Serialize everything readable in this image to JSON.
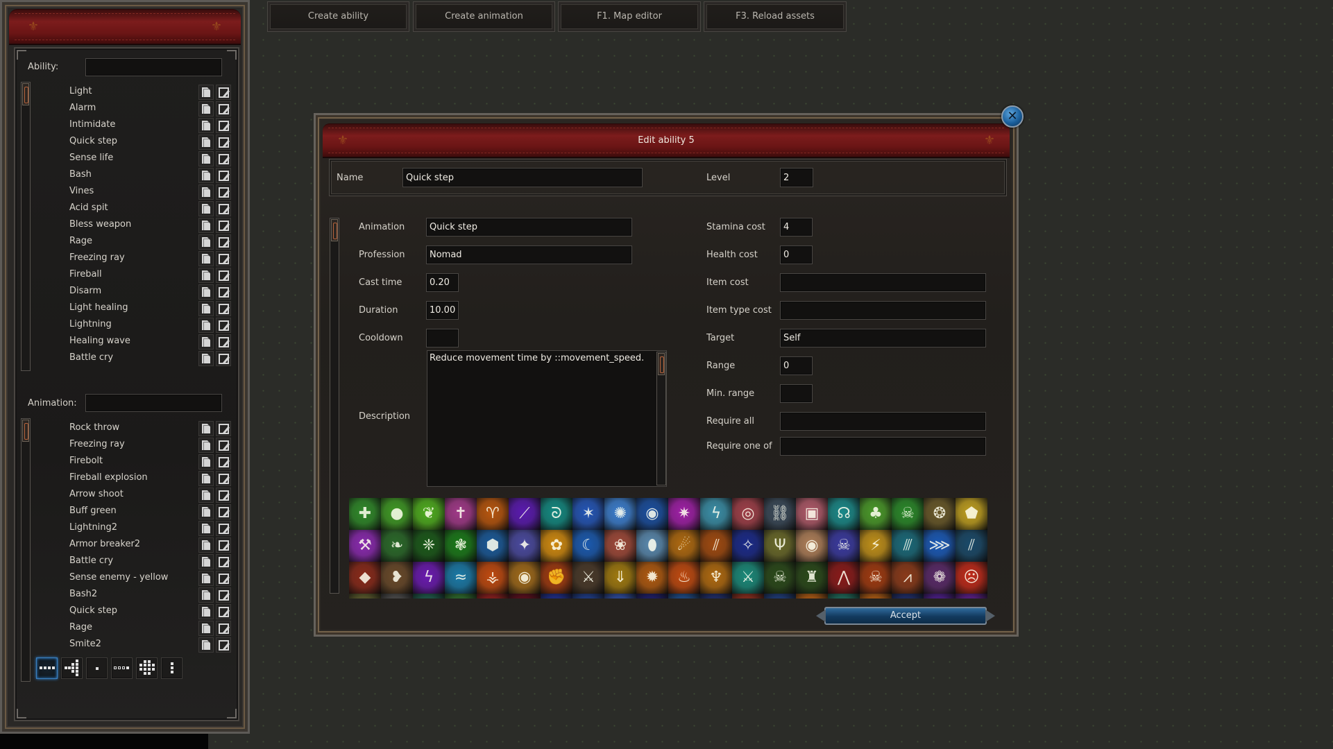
{
  "top_buttons": [
    {
      "label": "Create ability"
    },
    {
      "label": "Create animation"
    },
    {
      "label": "F1. Map editor"
    },
    {
      "label": "F3. Reload assets"
    }
  ],
  "left_panel": {
    "ability_label": "Ability:",
    "ability_filter": "",
    "abilities": [
      "Light",
      "Alarm",
      "Intimidate",
      "Quick step",
      "Sense life",
      "Bash",
      "Vines",
      "Acid spit",
      "Bless weapon",
      "Rage",
      "Freezing ray",
      "Fireball",
      "Disarm",
      "Light healing",
      "Lightning",
      "Healing wave",
      "Battle cry"
    ],
    "animation_label": "Animation:",
    "animation_filter": "",
    "animations": [
      "Rock throw",
      "Freezing ray",
      "Firebolt",
      "Fireball explosion",
      "Arrow shoot",
      "Buff green",
      "Lightning2",
      "Armor breaker2",
      "Battle cry",
      "Sense enemy - yellow",
      "Bash2",
      "Quick step",
      "Rage",
      "Smite2"
    ],
    "row_actions": {
      "copy": "copy-icon",
      "edit": "edit-icon"
    },
    "layout_buttons": [
      {
        "name": "line-4-layout",
        "selected": true
      },
      {
        "name": "arrow-layout",
        "selected": false
      },
      {
        "name": "single-layout",
        "selected": false
      },
      {
        "name": "line-3-plus-1-layout",
        "selected": false
      },
      {
        "name": "circle-layout",
        "selected": false
      },
      {
        "name": "column-3-layout",
        "selected": false
      }
    ]
  },
  "dialog": {
    "title": "Edit ability 5",
    "close_icon": "close-icon",
    "name": {
      "label": "Name",
      "value": "Quick step"
    },
    "level": {
      "label": "Level",
      "value": "2"
    },
    "left_fields": [
      {
        "key": "animation",
        "label": "Animation",
        "value": "Quick step",
        "wide": true
      },
      {
        "key": "profession",
        "label": "Profession",
        "value": "Nomad",
        "wide": true
      },
      {
        "key": "cast_time",
        "label": "Cast time",
        "value": "0.20",
        "wide": false
      },
      {
        "key": "duration",
        "label": "Duration",
        "value": "10.00",
        "wide": false
      },
      {
        "key": "cooldown",
        "label": "Cooldown",
        "value": "",
        "wide": false
      }
    ],
    "description": {
      "label": "Description",
      "value": "Reduce movement time by ::movement_speed."
    },
    "right_fields": [
      {
        "key": "stamina_cost",
        "label": "Stamina cost",
        "value": "4",
        "wide": false
      },
      {
        "key": "health_cost",
        "label": "Health cost",
        "value": "0",
        "wide": false
      },
      {
        "key": "item_cost",
        "label": "Item cost",
        "value": "",
        "wide": true
      },
      {
        "key": "item_type_cost",
        "label": "Item type cost",
        "value": "",
        "wide": true
      },
      {
        "key": "target",
        "label": "Target",
        "value": "Self",
        "wide": true
      },
      {
        "key": "range",
        "label": "Range",
        "value": "0",
        "wide": false
      },
      {
        "key": "min_range",
        "label": "Min. range",
        "value": "",
        "wide": false
      },
      {
        "key": "require_all",
        "label": "Require all",
        "value": "",
        "wide": true
      },
      {
        "key": "require_one_of",
        "label": "Require one of",
        "value": "",
        "wide": true
      }
    ],
    "icons": [
      {
        "name": "holy-cross-icon",
        "glyph": "✚",
        "bg": "#2f8a2a"
      },
      {
        "name": "acid-orb-icon",
        "glyph": "●",
        "bg": "#3f9a25"
      },
      {
        "name": "leaf-icon",
        "glyph": "❦",
        "bg": "#4fae1f"
      },
      {
        "name": "holy-sword-icon",
        "glyph": "✝",
        "bg": "#a23a8a"
      },
      {
        "name": "ram-head-icon",
        "glyph": "♈",
        "bg": "#b8560e"
      },
      {
        "name": "purple-beam-icon",
        "glyph": "⟋",
        "bg": "#5a1ab0"
      },
      {
        "name": "teal-swirl-icon",
        "glyph": "ᘐ",
        "bg": "#138a82"
      },
      {
        "name": "ice-shards-icon",
        "glyph": "✶",
        "bg": "#2456b8"
      },
      {
        "name": "frost-burst-icon",
        "glyph": "✺",
        "bg": "#3c7fd0"
      },
      {
        "name": "water-orb-icon",
        "glyph": "◉",
        "bg": "#1a4fa0"
      },
      {
        "name": "radiant-figure-icon",
        "glyph": "✷",
        "bg": "#a020a8"
      },
      {
        "name": "lightning-cage-icon",
        "glyph": "ϟ",
        "bg": "#3a8fa8"
      },
      {
        "name": "dragon-eye-icon",
        "glyph": "◎",
        "bg": "#a0404a"
      },
      {
        "name": "chain-icon",
        "glyph": "⛓",
        "bg": "#3a4a5a"
      },
      {
        "name": "spellbook-icon",
        "glyph": "▣",
        "bg": "#b05a6a"
      },
      {
        "name": "kraken-icon",
        "glyph": "☊",
        "bg": "#1a8a8a"
      },
      {
        "name": "vine-icon",
        "glyph": "♣",
        "bg": "#4a9a2a"
      },
      {
        "name": "poison-skull-icon",
        "glyph": "☠",
        "bg": "#2a8a2a"
      },
      {
        "name": "treant-icon",
        "glyph": "❂",
        "bg": "#6a5a2a"
      },
      {
        "name": "gold-armor-icon",
        "glyph": "⬟",
        "bg": "#c0a020"
      },
      {
        "name": "purple-axe-icon",
        "glyph": "⚒",
        "bg": "#8a2ab0"
      },
      {
        "name": "olive-branch-icon",
        "glyph": "❧",
        "bg": "#2a6a2a"
      },
      {
        "name": "green-wisp-icon",
        "glyph": "❈",
        "bg": "#1a5a1a"
      },
      {
        "name": "green-tentacles-icon",
        "glyph": "❃",
        "bg": "#1a7a1a"
      },
      {
        "name": "crystal-shield-icon",
        "glyph": "⬢",
        "bg": "#1a5a9a"
      },
      {
        "name": "star-burst-icon",
        "glyph": "✦",
        "bg": "#4a4aa0"
      },
      {
        "name": "golden-brain-icon",
        "glyph": "✿",
        "bg": "#d08a10"
      },
      {
        "name": "ice-wave-icon",
        "glyph": "☾",
        "bg": "#1a5ab0"
      },
      {
        "name": "paw-print-icon",
        "glyph": "❀",
        "bg": "#a04a3a"
      },
      {
        "name": "frost-egg-icon",
        "glyph": "⬮",
        "bg": "#5a8ab0"
      },
      {
        "name": "fire-comet-icon",
        "glyph": "☄",
        "bg": "#b06a10"
      },
      {
        "name": "flame-slash-icon",
        "glyph": "⫽",
        "bg": "#a04a10"
      },
      {
        "name": "blue-stars-icon",
        "glyph": "✧",
        "bg": "#1a2a8a"
      },
      {
        "name": "golden-antler-icon",
        "glyph": "Ψ",
        "bg": "#6a6a2a"
      },
      {
        "name": "eye-icon",
        "glyph": "◉",
        "bg": "#b0805a"
      },
      {
        "name": "spectral-skull-icon",
        "glyph": "☠",
        "bg": "#3a3aa0"
      },
      {
        "name": "golden-slash-icon",
        "glyph": "⚡",
        "bg": "#c0901a"
      },
      {
        "name": "teal-blades-icon",
        "glyph": "⫻",
        "bg": "#1a6a7a"
      },
      {
        "name": "blue-rays-icon",
        "glyph": "⋙",
        "bg": "#1a5ab8"
      },
      {
        "name": "ice-claws-icon",
        "glyph": "⫽",
        "bg": "#1a4a6a"
      },
      {
        "name": "rock-smash-icon",
        "glyph": "◆",
        "bg": "#8a2a1a"
      },
      {
        "name": "fire-claw-icon",
        "glyph": "❥",
        "bg": "#6a4a2a"
      },
      {
        "name": "purple-lightning-icon",
        "glyph": "ϟ",
        "bg": "#6a1ab0"
      },
      {
        "name": "dolphin-icon",
        "glyph": "≈",
        "bg": "#1a7aa8"
      },
      {
        "name": "fire-rune-icon",
        "glyph": "⚶",
        "bg": "#c04a10"
      },
      {
        "name": "red-eye-icon",
        "glyph": "◉",
        "bg": "#a06a1a"
      },
      {
        "name": "flame-fist-icon",
        "glyph": "✊",
        "bg": "#a03a10"
      },
      {
        "name": "battle-axe-icon",
        "glyph": "⚔",
        "bg": "#4a3a2a"
      },
      {
        "name": "light-pillar-icon",
        "glyph": "⇓",
        "bg": "#a07a10"
      },
      {
        "name": "lava-crack-icon",
        "glyph": "✹",
        "bg": "#b05a10"
      },
      {
        "name": "firestorm-icon",
        "glyph": "♨",
        "bg": "#c04a10"
      },
      {
        "name": "fire-fence-icon",
        "glyph": "♆",
        "bg": "#b06a10"
      },
      {
        "name": "crossed-swords-icon",
        "glyph": "⚔",
        "bg": "#1a8a7a"
      },
      {
        "name": "skeleton-icon",
        "glyph": "☠",
        "bg": "#2a4a1a"
      },
      {
        "name": "totem-icon",
        "glyph": "♜",
        "bg": "#2a4a1a"
      },
      {
        "name": "fangs-icon",
        "glyph": "⋀",
        "bg": "#8a1a1a"
      },
      {
        "name": "flaming-skull-icon",
        "glyph": "☠",
        "bg": "#a03a10"
      },
      {
        "name": "talons-icon",
        "glyph": "⩘",
        "bg": "#8a3a1a"
      },
      {
        "name": "carnivorous-plant-icon",
        "glyph": "❁",
        "bg": "#5a2a6a"
      },
      {
        "name": "mask-icon",
        "glyph": "☹",
        "bg": "#c02a1a"
      },
      {
        "name": "row4-icon-1",
        "glyph": "",
        "bg": "#5a5a2a"
      },
      {
        "name": "row4-icon-2",
        "glyph": "",
        "bg": "#4a4a4a"
      },
      {
        "name": "row4-icon-3",
        "glyph": "",
        "bg": "#1a5a4a"
      },
      {
        "name": "row4-icon-4",
        "glyph": "",
        "bg": "#2a6a2a"
      },
      {
        "name": "row4-icon-5",
        "glyph": "",
        "bg": "#8a1a1a"
      },
      {
        "name": "row4-icon-6",
        "glyph": "",
        "bg": "#5a0a1a"
      },
      {
        "name": "row4-icon-7",
        "glyph": "",
        "bg": "#1a2a8a"
      },
      {
        "name": "row4-icon-8",
        "glyph": "",
        "bg": "#1a3a8a"
      },
      {
        "name": "row4-icon-9",
        "glyph": "",
        "bg": "#2a4aa0"
      },
      {
        "name": "row4-icon-10",
        "glyph": "",
        "bg": "#1a1a6a"
      },
      {
        "name": "row4-icon-11",
        "glyph": "",
        "bg": "#1a4a8a"
      },
      {
        "name": "row4-icon-12",
        "glyph": "",
        "bg": "#1a2a6a"
      },
      {
        "name": "row4-icon-13",
        "glyph": "",
        "bg": "#8a2a1a"
      },
      {
        "name": "row4-icon-14",
        "glyph": "",
        "bg": "#1a3a7a"
      },
      {
        "name": "row4-icon-15",
        "glyph": "",
        "bg": "#b05a10"
      },
      {
        "name": "row4-icon-16",
        "glyph": "",
        "bg": "#1a6a5a"
      },
      {
        "name": "row4-icon-17",
        "glyph": "",
        "bg": "#b05a10"
      },
      {
        "name": "row4-icon-18",
        "glyph": "",
        "bg": "#1a2a6a"
      },
      {
        "name": "row4-icon-19",
        "glyph": "",
        "bg": "#4a1a8a"
      },
      {
        "name": "row4-icon-20",
        "glyph": "",
        "bg": "#5a1a8a"
      }
    ],
    "accept_label": "Accept"
  }
}
